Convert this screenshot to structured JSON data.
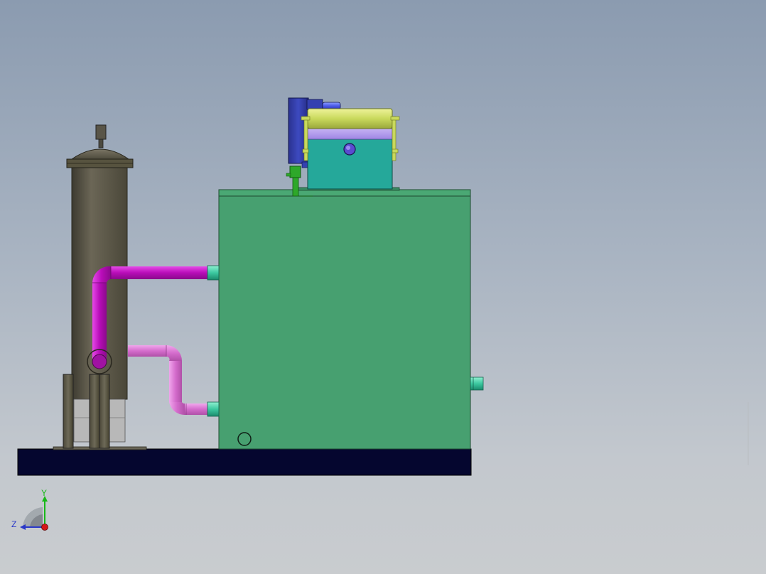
{
  "viewport": {
    "background_top": "#8b9bb0",
    "background_bottom": "#c9cccf"
  },
  "scene": {
    "model": "filter-vessel-and-tank-assembly",
    "colors": {
      "base": "#05062f",
      "tank": "#47a070",
      "vessel": "#5b5748",
      "upper_pipe": "#b510b8",
      "lower_pipe": "#d86cd0",
      "pump_body": "#25a89a",
      "pump_cap": "#c8d860",
      "motor": "#2f3aa8",
      "nozzle": "#3cc8a0",
      "valve": "#2ea82a"
    }
  },
  "triad": {
    "y_label": "Y",
    "z_label": "Z",
    "y_color": "#18b818",
    "z_color": "#2a38c8",
    "x_color": "#d41818"
  }
}
